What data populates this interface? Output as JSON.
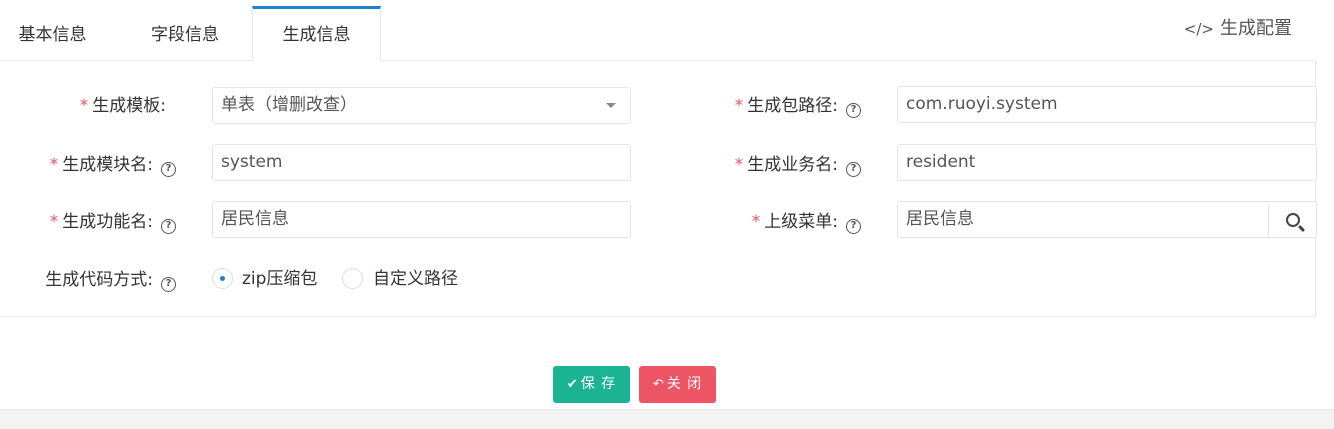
{
  "tabs": [
    {
      "label": "基本信息"
    },
    {
      "label": "字段信息"
    },
    {
      "label": "生成信息"
    }
  ],
  "panel_title": "生成配置",
  "form": {
    "template": {
      "label": "生成模板:",
      "value": "单表（增删改查）"
    },
    "package": {
      "label": "生成包路径:",
      "value": "com.ruoyi.system"
    },
    "module": {
      "label": "生成模块名:",
      "value": "system"
    },
    "business": {
      "label": "生成业务名:",
      "value": "resident"
    },
    "function": {
      "label": "生成功能名:",
      "value": "居民信息"
    },
    "parent_menu": {
      "label": "上级菜单:",
      "value": "居民信息"
    },
    "gen_type": {
      "label": "生成代码方式:",
      "options": [
        {
          "label": "zip压缩包",
          "checked": true
        },
        {
          "label": "自定义路径",
          "checked": false
        }
      ]
    }
  },
  "required_mark": "*",
  "help_glyph": "?",
  "buttons": {
    "save": "保 存",
    "close": "关 闭"
  },
  "colors": {
    "accent": "#1c84c6",
    "save": "#1ab394",
    "close": "#ed5565",
    "required": "#ed5565"
  }
}
